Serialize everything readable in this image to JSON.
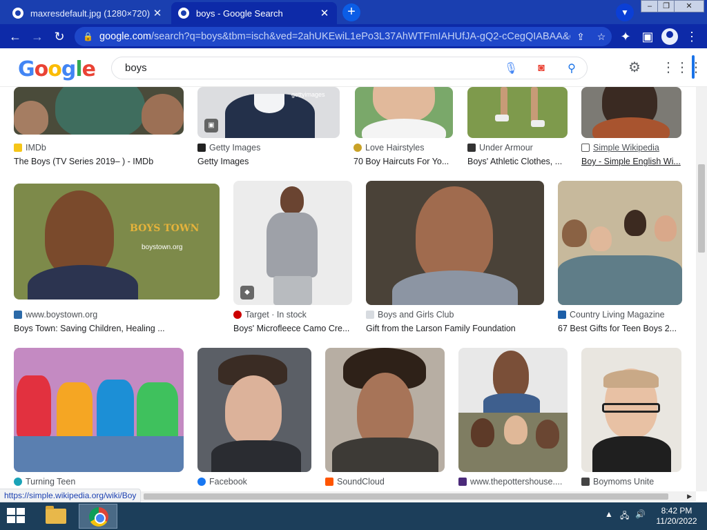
{
  "tabs": [
    {
      "title": "maxresdefault.jpg (1280×720)",
      "close": "✕"
    },
    {
      "title": "boys - Google Search",
      "close": "✕"
    }
  ],
  "newtab": "+",
  "address": {
    "host": "google.com",
    "path": "/search?q=boys&tbm=isch&ved=2ahUKEwiL1ePo3L37AhWTFmIAHUfJA-gQ2-cCegQIABAA&o..."
  },
  "search": {
    "query": "boys"
  },
  "logo": {
    "letters": [
      "G",
      "o",
      "o",
      "g",
      "l",
      "e"
    ],
    "colors": [
      "#4285f4",
      "#ea4335",
      "#fbbc05",
      "#4285f4",
      "#34a853",
      "#ea4335"
    ]
  },
  "results": [
    {
      "source": "IMDb",
      "caption": "The Boys (TV Series 2019– ) - IMDb"
    },
    {
      "source": "Getty Images",
      "caption": "Getty Images"
    },
    {
      "source": "Love Hairstyles",
      "caption": "70 Boy Haircuts For Yo..."
    },
    {
      "source": "Under Armour",
      "caption": "Boys' Athletic Clothes, ..."
    },
    {
      "source": "Simple Wikipedia",
      "caption": "Boy - Simple English Wi..."
    },
    {
      "source": "www.boystown.org",
      "caption": "Boys Town: Saving Children, Healing ..."
    },
    {
      "source": "Target · In stock",
      "caption": "Boys' Microfleece Camo Cre..."
    },
    {
      "source": "Boys and Girls Club",
      "caption": "Gift from the Larson Family Foundation"
    },
    {
      "source": "Country Living Magazine",
      "caption": "67 Best Gifts for Teen Boys 2..."
    },
    {
      "source": "Turning Teen",
      "caption": ""
    },
    {
      "source": "Facebook",
      "caption": ""
    },
    {
      "source": "SoundCloud",
      "caption": ""
    },
    {
      "source": "www.thepottershouse....",
      "caption": ""
    },
    {
      "source": "Boymoms Unite",
      "caption": ""
    }
  ],
  "watermarks": {
    "getty": "gettyimages",
    "boystown_logo": "BOYS TOWN",
    "boystown_url": "boystown.org"
  },
  "status_url": "https://simple.wikipedia.org/wiki/Boy",
  "clock": {
    "time": "8:42 PM",
    "date": "11/20/2022"
  }
}
